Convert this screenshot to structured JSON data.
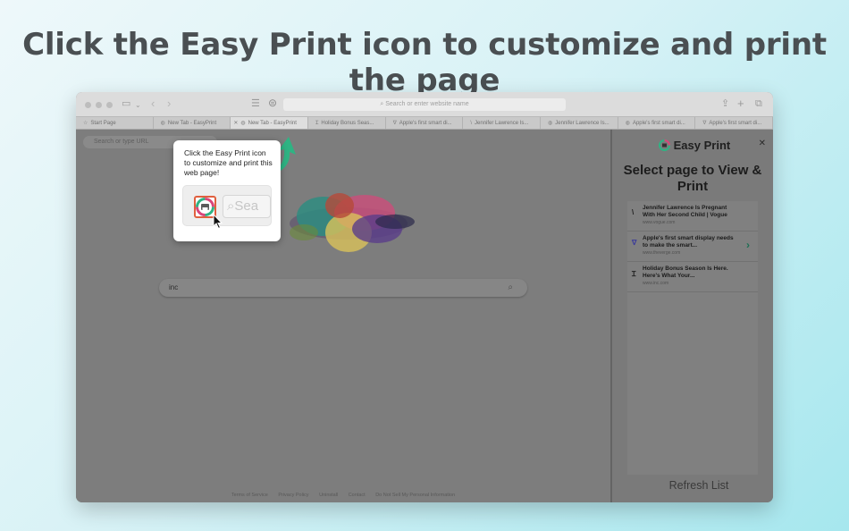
{
  "headline": "Click the Easy Print icon to customize and print the page",
  "browser": {
    "address_placeholder": "Search or enter website name",
    "tabs": [
      {
        "icon": "star-icon",
        "glyph": "☆",
        "label": "Start Page"
      },
      {
        "icon": "easyprint-tab-icon",
        "glyph": "◍",
        "label": "New Tab - EasyPrint"
      },
      {
        "icon": "easyprint-tab-icon",
        "glyph": "◍",
        "label": "New Tab - EasyPrint"
      },
      {
        "icon": "inc-tab-icon",
        "glyph": "Ɪ",
        "label": "Holiday Bonus Seas..."
      },
      {
        "icon": "verge-tab-icon",
        "glyph": "∇",
        "label": "Apple's first smart di..."
      },
      {
        "icon": "vogue-tab-icon",
        "glyph": "\\",
        "label": "Jennifer Lawrence Is..."
      },
      {
        "icon": "easyprint-tab-icon",
        "glyph": "◍",
        "label": "Jennifer Lawrence Is..."
      },
      {
        "icon": "easyprint-tab-icon",
        "glyph": "◍",
        "label": "Apple's first smart di..."
      },
      {
        "icon": "verge-tab-icon",
        "glyph": "∇",
        "label": "Apple's first smart di..."
      }
    ]
  },
  "page": {
    "url_placeholder": "Search or type URL",
    "search_value": "inc",
    "footer_links": [
      "Terms of Service",
      "Privacy Policy",
      "Uninstall",
      "Contact",
      "Do Not Sell My Personal Information"
    ]
  },
  "popup": {
    "text": "Click the Easy Print icon to customize and print this web page!",
    "demo_search": "Sea"
  },
  "panel": {
    "brand": "Easy Print",
    "title": "Select page to View & Print",
    "items": [
      {
        "glyph": "\\",
        "title": "Jennifer Lawrence Is Pregnant With Her Second Child | Vogue",
        "url": "www.vogue.com"
      },
      {
        "glyph": "∇",
        "title": "Apple's first smart display needs to make the smart...",
        "url": "www.theverge.com"
      },
      {
        "glyph": "Ɪ",
        "title": "Holiday Bonus Season Is Here. Here's What Your...",
        "url": "www.inc.com"
      }
    ],
    "refresh": "Refresh List"
  },
  "colors": {
    "accent_green": "#2fb383",
    "highlight_red": "#e0603f"
  }
}
